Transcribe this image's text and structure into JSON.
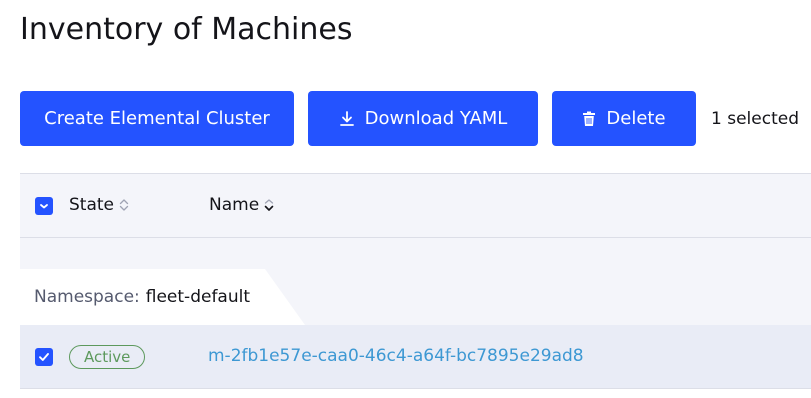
{
  "page": {
    "title": "Inventory of Machines"
  },
  "toolbar": {
    "create_label": "Create Elemental Cluster",
    "download_label": "Download YAML",
    "delete_label": "Delete",
    "selected_text": "1 selected"
  },
  "table": {
    "columns": [
      {
        "label": "State",
        "sort_icon": "sort-both-icon"
      },
      {
        "label": "Name",
        "sort_icon": "sort-down-icon"
      }
    ],
    "select_all_state": "partial",
    "groups": [
      {
        "namespace_label": "Namespace:",
        "namespace_value": "fleet-default",
        "rows": [
          {
            "checked": true,
            "state": "Active",
            "name": "m-2fb1e57e-caa0-46c4-a64f-bc7895e29ad8"
          }
        ]
      }
    ]
  },
  "colors": {
    "primary": "#2453ff",
    "active_status": "#5d995d",
    "link": "#3d98d3",
    "header_bg": "#f4f5fa",
    "selected_row_bg": "#e9ecf6"
  },
  "icons": {
    "download": "download-icon",
    "delete": "trash-icon",
    "checkbox_partial": "minus-icon",
    "checkbox_checked": "checkmark-icon"
  }
}
